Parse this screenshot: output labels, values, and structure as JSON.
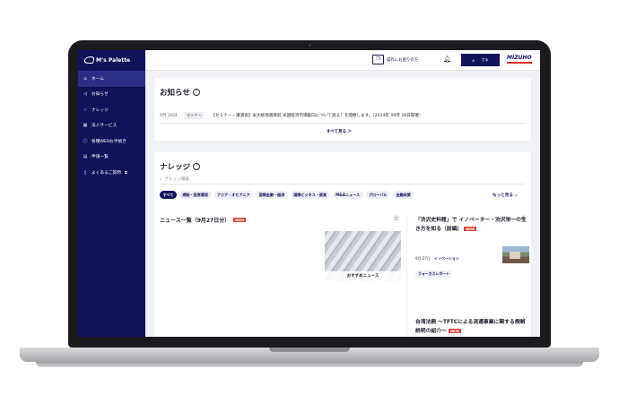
{
  "app": {
    "logo_text": "M’s Palette"
  },
  "sidebar": {
    "items": [
      {
        "icon": "home-icon",
        "glyph": "⌂",
        "label": "ホーム",
        "active": true
      },
      {
        "icon": "megaphone-icon",
        "glyph": "◁",
        "label": "お知らせ"
      },
      {
        "icon": "bulb-icon",
        "glyph": "♢",
        "label": "ナレッジ"
      },
      {
        "icon": "building-icon",
        "glyph": "▦",
        "label": "法人サービス"
      },
      {
        "icon": "info-icon",
        "glyph": "ⓘ",
        "label": "各種WEBお手続き"
      },
      {
        "icon": "document-icon",
        "glyph": "▤",
        "label": "申請一覧"
      },
      {
        "icon": "book-icon",
        "glyph": "▯",
        "label": "よくあるご質問"
      }
    ]
  },
  "header": {
    "help_label": "操作にお困りの方",
    "user_label": "さま",
    "brand": "MIZUHO"
  },
  "notice": {
    "title": "お知らせ",
    "item": {
      "date": "9月 26日",
      "tag": "セミナー",
      "text": "【セミナー・講演会】米大統領選目前 米国経済市場動向について語る！を開催します。（2024年 09月 28日開催）"
    },
    "see_all": "すべて見る ＞"
  },
  "knowledge": {
    "title": "ナレッジ",
    "search_placeholder": "ナレッジ検索",
    "chips": [
      "すべて",
      "規制・投資環境",
      "アジア・オセアニア",
      "国際金融・経済",
      "国際ビジネス・貿易",
      "M&Aニュース",
      "グローバル",
      "金融政策"
    ],
    "more": "もっと見る ⌵",
    "main": {
      "title": "ニュース一覧（9月27日分）",
      "badge": "NEW",
      "thumb_caption": "おすすめニュース"
    },
    "side": [
      {
        "title": "「渋沢史料館」で イノベーター・渋沢栄一の生き方を知る（前編）",
        "badge": "NEW",
        "date": "9月 27日",
        "category": "イノベーション",
        "tag": "フォーカスレポート"
      },
      {
        "title": "台湾法務 〜TFTCによる流通事業に関する規制説明の紹介〜",
        "badge": "NEW"
      }
    ]
  },
  "colors": {
    "navy": "#12125a",
    "accent_red": "#d8453b"
  }
}
